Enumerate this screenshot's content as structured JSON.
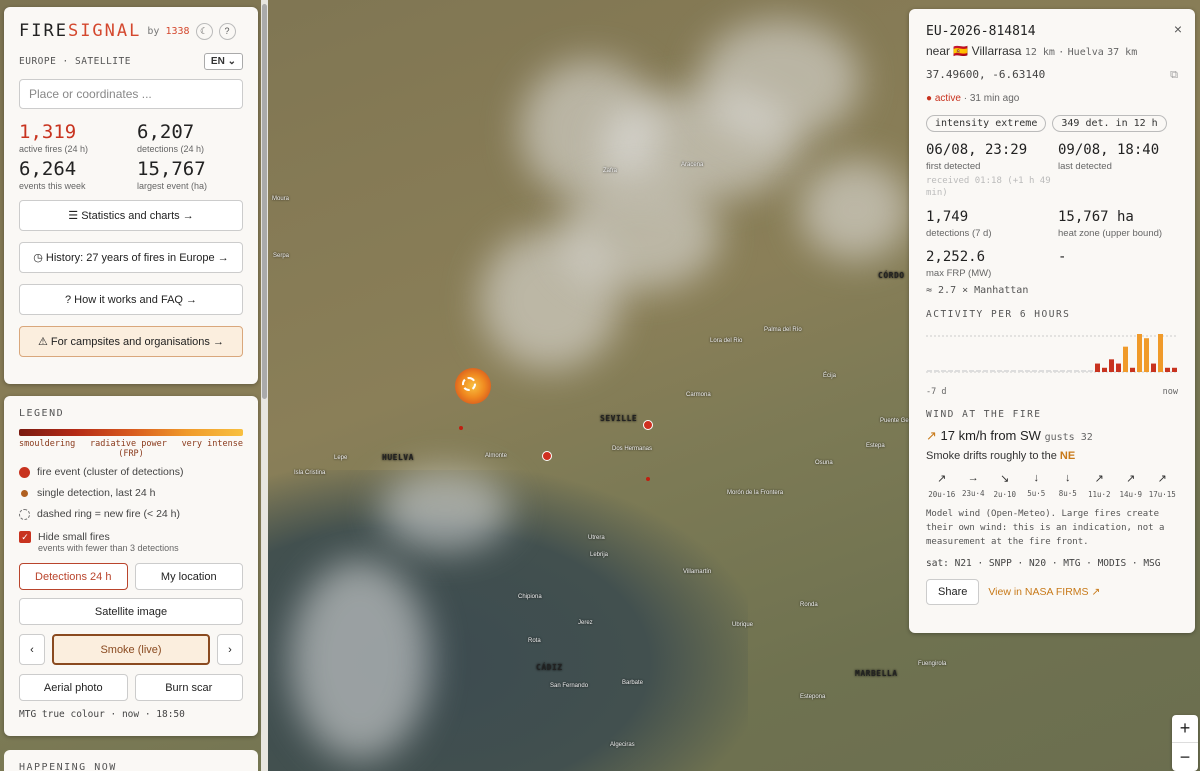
{
  "brand": {
    "logo_a": "FIRE",
    "logo_b": "SIGNAL",
    "by": "by",
    "by_num": "1338",
    "theme_btn": "☾",
    "help_btn": "?"
  },
  "region": {
    "label": "EUROPE · SATELLITE",
    "lang": "EN"
  },
  "search": {
    "placeholder": "Place or coordinates ..."
  },
  "stats": [
    {
      "value": "1,319",
      "label": "active fires (24 h)"
    },
    {
      "value": "6,207",
      "label": "detections (24 h)"
    },
    {
      "value": "6,264",
      "label": "events this week"
    },
    {
      "value": "15,767",
      "label": "largest event (ha)"
    }
  ],
  "nav": {
    "stats": "☰ Statistics and charts →",
    "history": "◷ History: 27 years of fires in Europe →",
    "faq": "? How it works and FAQ →",
    "campsites": "⚠ For campsites and organisations →"
  },
  "legend": {
    "title": "LEGEND",
    "grad_left": "smouldering",
    "grad_mid": "radiative power",
    "grad_right": "very intense",
    "grad_sub": "(FRP)",
    "item1": "fire event (cluster of detections)",
    "item2": "single detection, last 24 h",
    "item3": "dashed ring = new fire (< 24 h)",
    "hide": "Hide small fires",
    "hide_sub": "events with fewer than 3 detections"
  },
  "controls": {
    "detections": "Detections 24 h",
    "location": "My location",
    "satellite": "Satellite image",
    "prev": "‹",
    "smoke": "Smoke (live)",
    "next": "›",
    "aerial": "Aerial photo",
    "burn": "Burn scar",
    "mtg": "MTG true colour · now · 18:50"
  },
  "happening": {
    "title": "HAPPENING NOW"
  },
  "detail": {
    "id": "EU-2026-814814",
    "near_prefix": "near",
    "flag": "🇪🇸",
    "town": "Villarrasa",
    "town_km": "12 km",
    "sep": "·",
    "city": "Huelva",
    "city_km": "37 km",
    "coords": "37.49600, -6.63140",
    "copy_icon": "⧉",
    "status": "● active",
    "status_time": "· 31 min ago",
    "tag1": "intensity extreme",
    "tag2": "349 det. in 12 h",
    "first_detected": "06/08, 23:29",
    "first_label": "first detected",
    "received": "received 01:18 (+1 h 49 min)",
    "last_detected": "09/08, 18:40",
    "last_label": "last detected",
    "detections": "1,749",
    "detections_label": "detections (7 d)",
    "heat_zone": "15,767 ha",
    "heat_label": "heat zone (upper bound)",
    "frp": "2,252.6",
    "frp_label": "max FRP (MW)",
    "dash": "-",
    "manhattan": "≈ 2.7 × Manhattan",
    "activity_title": "ACTIVITY PER 6 HOURS",
    "axis_left": "-7 d",
    "axis_right": "now",
    "wind_title": "WIND AT THE FIRE",
    "wind_arrow": "↗",
    "wind": "17 km/h from SW",
    "gusts": "gusts 32",
    "drift_prefix": "Smoke drifts roughly to the",
    "drift_dir": "NE",
    "model_note": "Model wind (Open-Meteo). Large fires create their own wind: this is an indication, not a measurement at the fire front.",
    "sats": "sat: N21 · SNPP · N20 · MTG · MODIS · MSG",
    "share": "Share",
    "nasa": "View in NASA FIRMS ↗",
    "close": "×"
  },
  "wind_forecast": [
    {
      "arrow": "↗",
      "t": "20u·16"
    },
    {
      "arrow": "→",
      "t": "23u·4"
    },
    {
      "arrow": "↘",
      "t": "2u·10"
    },
    {
      "arrow": "↓",
      "t": "5u·5"
    },
    {
      "arrow": "↓",
      "t": "8u·5"
    },
    {
      "arrow": "↗",
      "t": "11u·2"
    },
    {
      "arrow": "↗",
      "t": "14u·9"
    },
    {
      "arrow": "↗",
      "t": "17u·15"
    }
  ],
  "activity_values": [
    0,
    0,
    0,
    0,
    0,
    0,
    0,
    0,
    0,
    0,
    0,
    0,
    0,
    0,
    0,
    0,
    0,
    0,
    0,
    0,
    0,
    0,
    0,
    0,
    2,
    1,
    3,
    2,
    6,
    1,
    9,
    8,
    2,
    9,
    1,
    1
  ],
  "map_labels": {
    "seville": "SEVILLE",
    "huelva": "HUELVA",
    "cadiz": "CÁDIZ",
    "cordoba": "CÓRDO",
    "marbella": "MARBELLA",
    "utrera": "Utrera",
    "jerez": "Jerez",
    "ecija": "Écija",
    "carmona": "Carmona",
    "moura": "Moura",
    "almonte": "Almonte",
    "lepe": "Lepe",
    "dos_hermanas": "Dos Hermanas",
    "rota": "Rota",
    "aracena": "Aracena",
    "zafra": "Zafra",
    "lora": "Lora del Rio",
    "sanfernando": "San Fernando",
    "chipiona": "Chipiona",
    "villamartin": "Villamartín",
    "lebrija": "Lebrija",
    "estepa": "Estepa",
    "osuna": "Osuna",
    "moron": "Morón de la Frontera",
    "ronda": "Ronda",
    "estepona": "Estepona",
    "fuengirola": "Fuengirola",
    "algeciras": "Algeciras",
    "barbate": "Barbate",
    "isla": "Isla Cristina",
    "serpa": "Serpa",
    "ubrique": "Ubrique",
    "palma": "Palma del Río",
    "puente": "Puente Genil"
  },
  "zoom": {
    "in": "+",
    "out": "−"
  }
}
